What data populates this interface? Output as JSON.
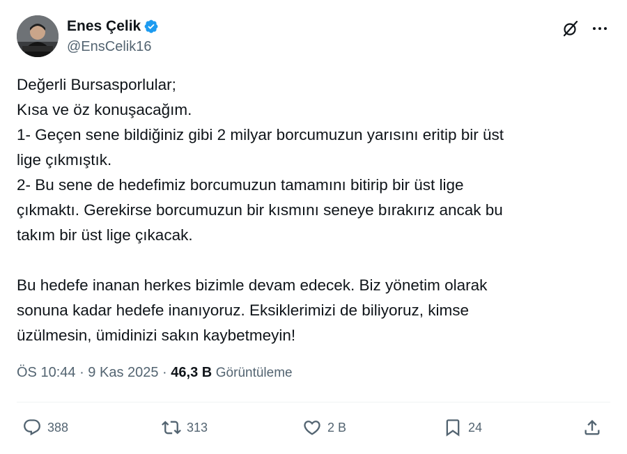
{
  "author": {
    "display_name": "Enes Çelik",
    "handle": "@EnsCelik16",
    "verified": true
  },
  "tweet": {
    "lines": [
      "Değerli Bursasporlular;",
      "Kısa ve öz konuşacağım.",
      "1- Geçen sene bildiğiniz gibi 2 milyar borcumuzun yarısını eritip bir üst",
      "lige çıkmıştık.",
      "2- Bu sene de hedefimiz borcumuzun tamamını bitirip bir üst lige",
      "çıkmaktı. Gerekirse borcumuzun bir kısmını seneye bırakırız ancak bu",
      "takım bir üst lige çıkacak.",
      "Bu hedefe inanan herkes bizimle devam edecek. Biz yönetim olarak",
      "sonuna kadar hedefe inanıyoruz. Eksiklerimizi de biliyoruz, kimse",
      "üzülmesin, ümidinizi sakın kaybetmeyin!"
    ]
  },
  "meta": {
    "time": "ÖS 10:44",
    "separator": " · ",
    "date": "9 Kas 2025",
    "views_count": "46,3 B",
    "views_label": "Görüntüleme"
  },
  "actions": {
    "replies": "388",
    "reposts": "313",
    "likes": "2 B",
    "bookmarks": "24"
  },
  "icons": {
    "verified": "verified-badge-icon",
    "grok": "grok-icon",
    "more": "more-icon",
    "reply": "reply-icon",
    "repost": "repost-icon",
    "like": "heart-icon",
    "bookmark": "bookmark-icon",
    "share": "share-icon"
  },
  "colors": {
    "text": "#0f1419",
    "secondary": "#536471",
    "verified": "#1d9bf0"
  }
}
